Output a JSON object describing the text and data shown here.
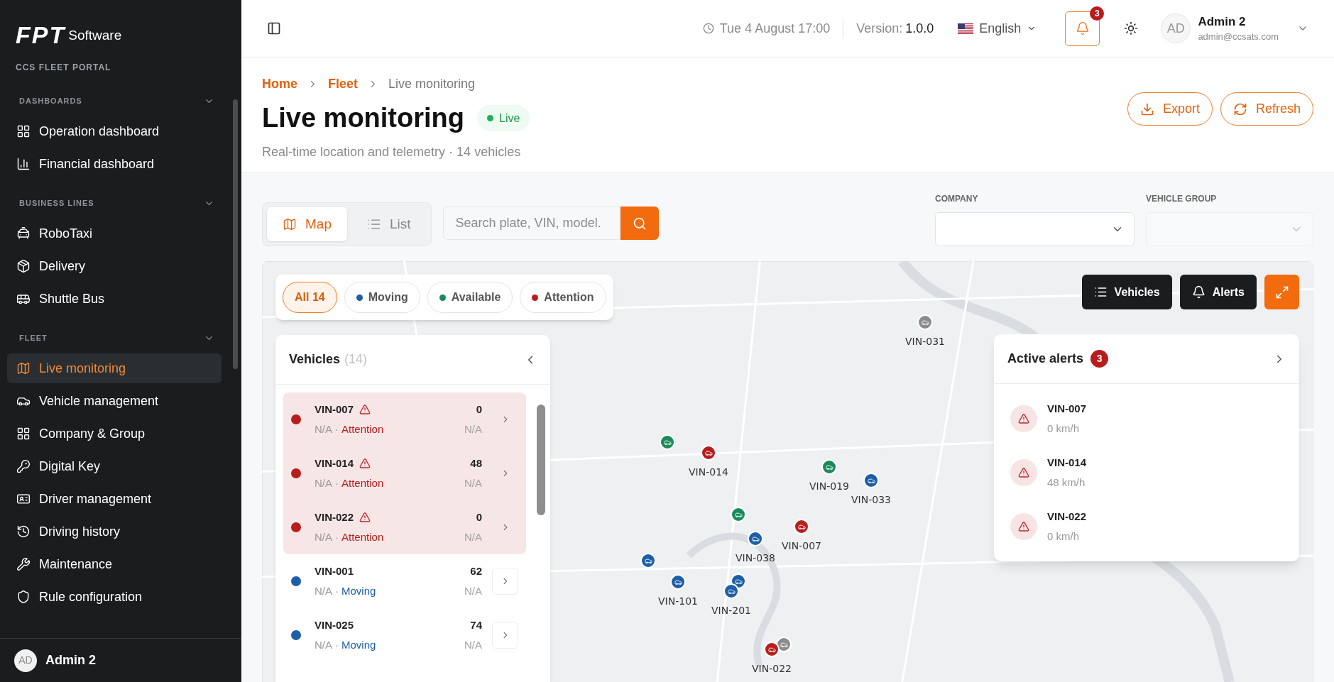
{
  "sidebar": {
    "logo": {
      "mark": "FPT",
      "text": "Software"
    },
    "portal": "CCS FLEET PORTAL",
    "sections": [
      {
        "title": "DASHBOARDS",
        "expanded": true,
        "items": [
          {
            "label": "Operation dashboard",
            "selected": false
          },
          {
            "label": "Financial dashboard",
            "selected": false
          }
        ]
      },
      {
        "title": "BUSINESS LINES",
        "expanded": true,
        "items": [
          {
            "label": "RoboTaxi",
            "selected": false
          },
          {
            "label": "Delivery",
            "selected": false
          },
          {
            "label": "Shuttle Bus",
            "selected": false
          }
        ]
      },
      {
        "title": "FLEET",
        "expanded": true,
        "items": [
          {
            "label": "Live monitoring",
            "selected": true
          },
          {
            "label": "Vehicle management",
            "selected": false
          },
          {
            "label": "Company & Group",
            "selected": false
          },
          {
            "label": "Digital Key",
            "selected": false
          },
          {
            "label": "Driver management",
            "selected": false
          },
          {
            "label": "Driving history",
            "selected": false
          },
          {
            "label": "Maintenance",
            "selected": false
          },
          {
            "label": "Rule configuration",
            "selected": false
          }
        ]
      }
    ],
    "user": {
      "initials": "AD",
      "name": "Admin 2"
    }
  },
  "topbar": {
    "datetime": "Tue 4 August 17:00",
    "version_label": "Version:",
    "version": "1.0.0",
    "language": "English",
    "notifications": "3",
    "user": {
      "initials": "AD",
      "name": "Admin 2",
      "email": "admin@ccsats.com"
    }
  },
  "header": {
    "breadcrumb": [
      {
        "label": "Home",
        "kind": "link"
      },
      {
        "label": "Fleet",
        "kind": "link"
      },
      {
        "label": "Live monitoring",
        "kind": "current"
      }
    ],
    "title": "Live monitoring",
    "status": "Live",
    "subtitle": "Real-time location and telemetry · 14 vehicles",
    "actions": [
      "Export",
      "Refresh"
    ]
  },
  "view_toggle": [
    {
      "label": "Map",
      "selected": true
    },
    {
      "label": "List",
      "selected": false
    }
  ],
  "search": {
    "placeholder": "Search plate, VIN, model."
  },
  "filters": [
    {
      "label": "COMPANY",
      "disabled": false
    },
    {
      "label": "VEHICLE GROUP",
      "disabled": true
    }
  ],
  "map": {
    "status_filters": [
      {
        "label": "All 14",
        "selected": true
      },
      {
        "label": "Moving",
        "selected": false,
        "color": "#1d5ea8"
      },
      {
        "label": "Available",
        "selected": false,
        "color": "#1a8a5a"
      },
      {
        "label": "Attention",
        "selected": false,
        "color": "#b91c1c"
      }
    ],
    "vehicles_panel": {
      "title": "Vehicles",
      "count": "(14)",
      "rows": [
        {
          "name": "VIN-007",
          "alert": true,
          "location": "N/A",
          "separator": "·",
          "status": "Attention",
          "color": "#b91c1c",
          "speed": "0",
          "extra": "N/A"
        },
        {
          "name": "VIN-014",
          "alert": true,
          "location": "N/A",
          "separator": "·",
          "status": "Attention",
          "color": "#b91c1c",
          "speed": "48",
          "extra": "N/A"
        },
        {
          "name": "VIN-022",
          "alert": true,
          "location": "N/A",
          "separator": "·",
          "status": "Attention",
          "color": "#b91c1c",
          "speed": "0",
          "extra": "N/A"
        },
        {
          "name": "VIN-001",
          "alert": false,
          "location": "N/A",
          "separator": "·",
          "status": "Moving",
          "color": "#1d5ea8",
          "speed": "62",
          "extra": "N/A"
        },
        {
          "name": "VIN-025",
          "alert": false,
          "location": "N/A",
          "separator": "·",
          "status": "Moving",
          "color": "#1d5ea8",
          "speed": "74",
          "extra": "N/A"
        }
      ]
    },
    "buttons": [
      "Vehicles",
      "Alerts"
    ],
    "alerts": {
      "title": "Active alerts",
      "count": "3",
      "items": [
        {
          "name": "VIN-007",
          "speed": "0 km/h"
        },
        {
          "name": "VIN-014",
          "speed": "48 km/h"
        },
        {
          "name": "VIN-022",
          "speed": "0 km/h"
        }
      ]
    },
    "markers": [
      {
        "label": "VIN-031",
        "color": "#8e8a8c"
      },
      {
        "color": "#1a8a5a"
      },
      {
        "label": "VIN-014",
        "color": "#b91c1c"
      },
      {
        "label": "VIN-019",
        "color": "#1a8a5a"
      },
      {
        "label": "VIN-033",
        "color": "#1d5ea8"
      },
      {
        "color": "#1a8a5a"
      },
      {
        "label": "VIN-007",
        "color": "#b91c1c"
      },
      {
        "label": "VIN-038",
        "color": "#1d5ea8"
      },
      {
        "color": "#1d5ea8"
      },
      {
        "label": "VIN-101",
        "color": "#1d5ea8"
      },
      {
        "color": "#1d5ea8"
      },
      {
        "label": "VIN-201",
        "color": "#1d5ea8"
      },
      {
        "color": "#8e8a8c"
      },
      {
        "label": "VIN-022",
        "color": "#b91c1c"
      }
    ]
  }
}
